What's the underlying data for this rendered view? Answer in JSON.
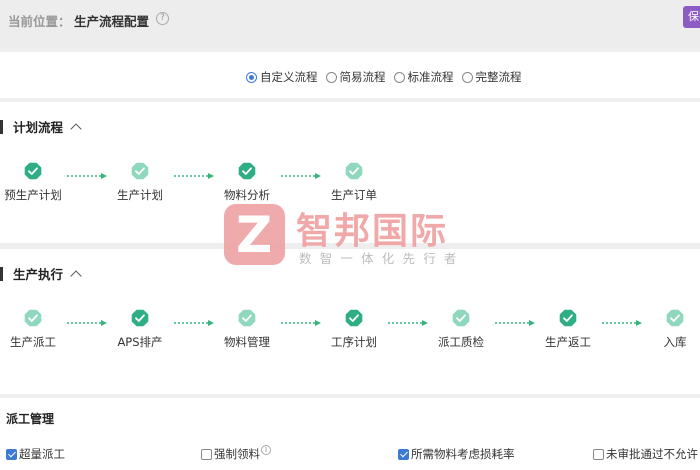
{
  "breadcrumb": {
    "label": "当前位置：",
    "title": "生产流程配置",
    "help_icon": "question-circle-icon"
  },
  "toolbar": {
    "save_label": "保存"
  },
  "flow_modes": {
    "options": [
      "自定义流程",
      "简易流程",
      "标准流程",
      "完整流程"
    ],
    "selected": "自定义流程"
  },
  "plan_section": {
    "title": "计划流程",
    "steps": [
      {
        "label": "预生产计划",
        "shade": "dark"
      },
      {
        "label": "生产计划",
        "shade": "light"
      },
      {
        "label": "物料分析",
        "shade": "dark"
      },
      {
        "label": "生产订单",
        "shade": "light"
      }
    ]
  },
  "exec_section": {
    "title": "生产执行",
    "steps": [
      {
        "label": "生产派工",
        "shade": "light"
      },
      {
        "label": "APS排产",
        "shade": "dark"
      },
      {
        "label": "物料管理",
        "shade": "light"
      },
      {
        "label": "工序计划",
        "shade": "dark"
      },
      {
        "label": "派工质检",
        "shade": "light"
      },
      {
        "label": "生产返工",
        "shade": "dark"
      },
      {
        "label": "入库",
        "shade": "light"
      }
    ]
  },
  "watermark": {
    "brand": "智邦国际",
    "slogan": "数智一体化先行者"
  },
  "dispatch": {
    "title": "派工管理",
    "options": [
      {
        "label": "超量派工",
        "checked": true
      },
      {
        "label": "强制领料",
        "checked": false,
        "info_icon": "info-circle-icon"
      },
      {
        "label": "所需物料考虑损耗率",
        "checked": true
      },
      {
        "label": "未审批通过不允许",
        "checked": false
      }
    ]
  },
  "colors": {
    "badge_dark": "#2fae86",
    "badge_light": "#8fd7bd",
    "accent": "#3d7ad6",
    "save": "#8d5bc4",
    "connector": "#33b57c"
  }
}
